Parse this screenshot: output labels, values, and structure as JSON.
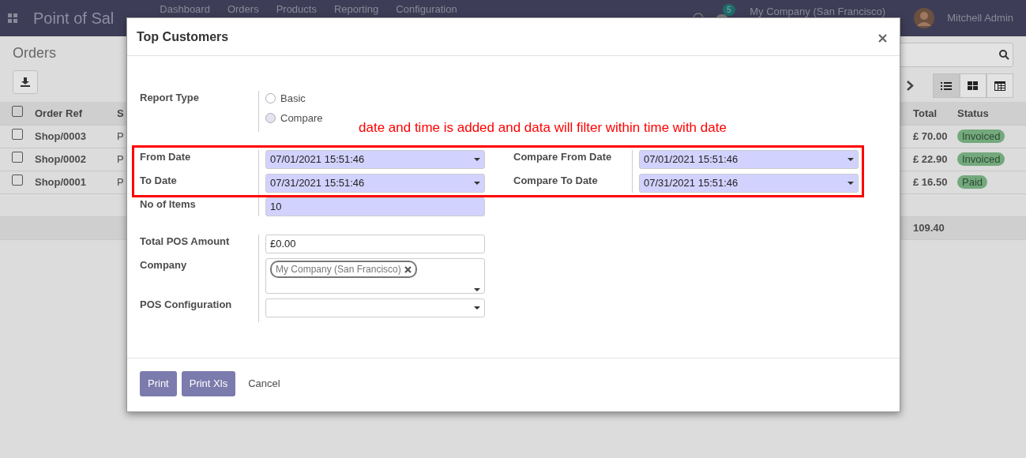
{
  "navbar": {
    "app_title": "Point of Sal",
    "menu": [
      "Dashboard",
      "Orders",
      "Products",
      "Reporting",
      "Configuration"
    ],
    "chat_count": "5",
    "company": "My Company (San Francisco)",
    "user": "Mitchell Admin"
  },
  "page": {
    "title": "Orders",
    "views": [
      {
        "kind": "list",
        "selected": true
      },
      {
        "kind": "kanban",
        "selected": false
      },
      {
        "kind": "pivot",
        "selected": false
      }
    ],
    "table": {
      "select_all": {
        "checked": false
      },
      "columns": [
        "Order Ref",
        "S",
        "Total",
        "Status"
      ],
      "rows": [
        {
          "order_ref": "Shop/0003",
          "column_2": "P",
          "total": "£ 70.00",
          "status": "Invoiced",
          "checked": false
        },
        {
          "order_ref": "Shop/0002",
          "column_2": "P",
          "total": "£ 22.90",
          "status": "Invoiced",
          "checked": false
        },
        {
          "order_ref": "Shop/0001",
          "column_2": "P",
          "total": "£ 16.50",
          "status": "Paid",
          "checked": false
        }
      ],
      "sum": "109.40"
    }
  },
  "dialog": {
    "title": "Top Customers",
    "report_type": {
      "label": "Report Type",
      "options": [
        {
          "label": "Basic",
          "selected": false
        },
        {
          "label": "Compare",
          "selected": true
        }
      ]
    },
    "annotation": "date and time is added and data will filter within time with date",
    "dates": [
      {
        "label": "From Date",
        "value": "07/01/2021 15:51:46",
        "required": true
      },
      {
        "label": "To Date",
        "value": "07/31/2021 15:51:46",
        "required": true
      }
    ],
    "compare_dates": [
      {
        "label": "Compare From Date",
        "value": "07/01/2021 15:51:46",
        "required": true
      },
      {
        "label": "Compare To Date",
        "value": "07/31/2021 15:51:46",
        "required": true
      }
    ],
    "items": {
      "label": "No of Items",
      "value": "10",
      "required": true
    },
    "amount": {
      "label": "Total POS Amount",
      "value": "£0.00",
      "required": false
    },
    "company": {
      "label": "Company",
      "tags": [
        "My Company (San Francisco)"
      ]
    },
    "pos_config": {
      "label": "POS Configuration"
    },
    "buttons": [
      {
        "label": "Print",
        "kind": "primary"
      },
      {
        "label": "Print Xls",
        "kind": "primary"
      },
      {
        "label": "Cancel",
        "kind": "link"
      }
    ]
  }
}
